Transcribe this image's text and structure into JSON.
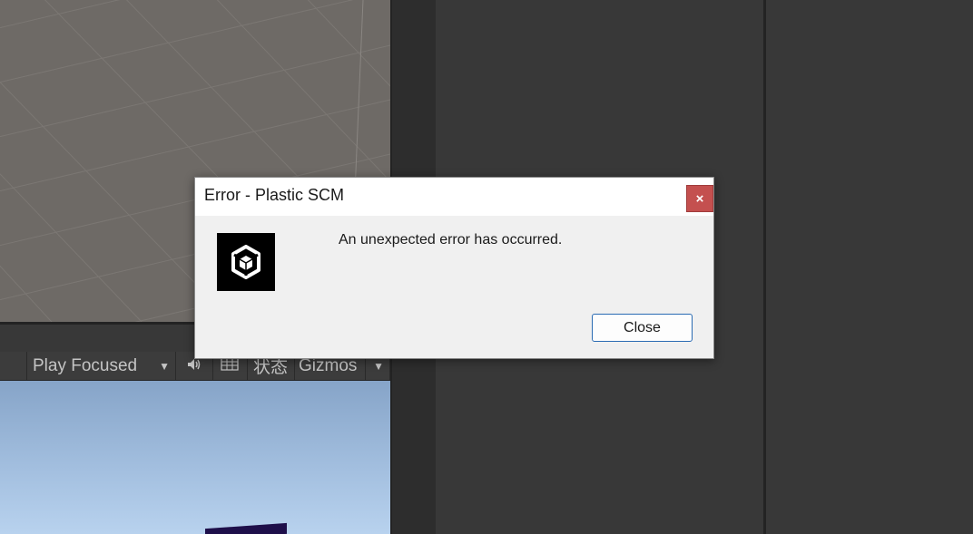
{
  "game_toolbar": {
    "play_mode": "Play Focused",
    "mute_icon": "speaker-icon",
    "stats_icon": "grid-icon",
    "stats_label": "状态",
    "gizmos_label": "Gizmos"
  },
  "dialog": {
    "title": "Error - Plastic SCM",
    "close_x": "×",
    "logo_icon": "unity-logo-icon",
    "message": "An unexpected error has occurred.",
    "close_button_label": "Close"
  },
  "colors": {
    "scene_bg": "#6e6a66",
    "close_x_bg": "#c4504f",
    "button_border": "#2a6bb3"
  }
}
